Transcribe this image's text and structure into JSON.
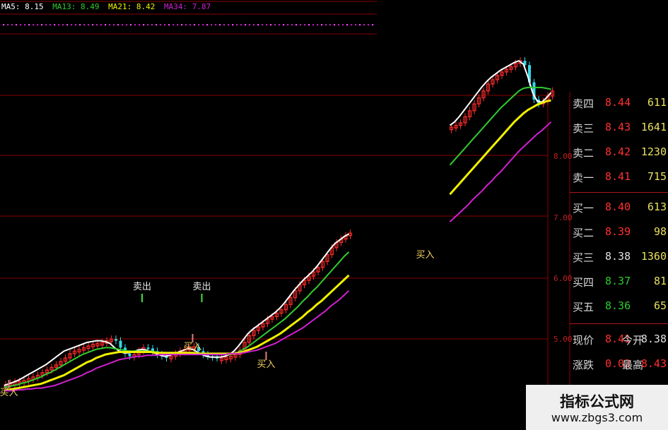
{
  "ma_legend": [
    {
      "label": "MA5: 8.15",
      "color": "#ffffff"
    },
    {
      "label": "MA13: 8.49",
      "color": "#2fcc2f"
    },
    {
      "label": "MA21: 8.42",
      "color": "#f0f000"
    },
    {
      "label": "MA34: 7.87",
      "color": "#d020d0"
    }
  ],
  "axis": {
    "y_ticks": [
      "8.00",
      "7.00",
      "6.00",
      "5.00"
    ]
  },
  "quote": {
    "sell": [
      {
        "label": "卖四",
        "price": "8.44",
        "vol": "611"
      },
      {
        "label": "卖三",
        "price": "8.43",
        "vol": "1641"
      },
      {
        "label": "卖二",
        "price": "8.42",
        "vol": "1230"
      },
      {
        "label": "卖一",
        "price": "8.41",
        "vol": "715"
      }
    ],
    "buy": [
      {
        "label": "买一",
        "price": "8.40",
        "vol": "613"
      },
      {
        "label": "买二",
        "price": "8.39",
        "vol": "98"
      },
      {
        "label": "买三",
        "price": "8.38",
        "vol": "1360"
      },
      {
        "label": "买四",
        "price": "8.37",
        "vol": "81"
      },
      {
        "label": "买五",
        "price": "8.36",
        "vol": "65"
      }
    ],
    "stats": [
      {
        "label": "现价",
        "value": "8.41",
        "label2": "今开",
        "value2": "8.38"
      },
      {
        "label": "涨跌",
        "value": "0.03",
        "label2": "最高",
        "value2": "8.43"
      }
    ]
  },
  "signals": [
    {
      "text": "买入"
    },
    {
      "text": "卖出"
    },
    {
      "text": "卖出"
    },
    {
      "text": "买入"
    },
    {
      "text": "买入"
    },
    {
      "text": "买入"
    }
  ],
  "watermark": {
    "title": "指标公式网",
    "url": "www.zbgs3.com"
  },
  "colors": {
    "up": "#ff2b2b",
    "down": "#35d9e6",
    "ma5": "#ffffff",
    "ma13": "#2fcc2f",
    "ma21": "#f0f000",
    "ma34": "#d020d0",
    "grid": "#8a0000"
  },
  "chart_data": {
    "type": "candlestick",
    "ylim": [
      4.6,
      8.6
    ],
    "segments": [
      {
        "x0": 0,
        "points": [
          4.79,
          4.81,
          4.82,
          4.83,
          4.84,
          4.86,
          4.88,
          4.9,
          4.93,
          4.96,
          4.99,
          5.02,
          5.06,
          5.1,
          5.15,
          5.18,
          5.2,
          5.22,
          5.24,
          5.26,
          5.27,
          5.28,
          5.3,
          5.32,
          5.3,
          5.22,
          5.15,
          5.12,
          5.14,
          5.18,
          5.22,
          5.21,
          5.18,
          5.14,
          5.12,
          5.1,
          5.12,
          5.15,
          5.18,
          5.2,
          5.22,
          5.23,
          5.18,
          5.14,
          5.12,
          5.11,
          5.1,
          5.1,
          5.11,
          5.12,
          5.14,
          5.19,
          5.28,
          5.36,
          5.42,
          5.46,
          5.5,
          5.55,
          5.58,
          5.62,
          5.66,
          5.72,
          5.8,
          5.88,
          5.95,
          6.0,
          6.05,
          6.1,
          6.15,
          6.22,
          6.3,
          6.38,
          6.44,
          6.48,
          6.52,
          6.55
        ]
      },
      {
        "x0": 97,
        "points": [
          7.78,
          7.8,
          7.83,
          7.9,
          7.97,
          8.05,
          8.12,
          8.2,
          8.28,
          8.33,
          8.38,
          8.42,
          8.45,
          8.48,
          8.52,
          8.55,
          8.5,
          8.3,
          8.1,
          8.05,
          8.08,
          8.14,
          8.2
        ]
      }
    ],
    "series": [
      {
        "name": "MA5",
        "color": "#ffffff",
        "segments": [
          {
            "x0": 0,
            "values": [
              4.78,
              4.8,
              4.82,
              4.84,
              4.87,
              4.9,
              4.93,
              4.96,
              4.99,
              5.02,
              5.06,
              5.1,
              5.14,
              5.18,
              5.2,
              5.22,
              5.24,
              5.26,
              5.28,
              5.29,
              5.3,
              5.3,
              5.29,
              5.27,
              5.22,
              5.18,
              5.16,
              5.16,
              5.17,
              5.19,
              5.2,
              5.19,
              5.17,
              5.15,
              5.13,
              5.12,
              5.13,
              5.15,
              5.17,
              5.19,
              5.21,
              5.2,
              5.17,
              5.14,
              5.12,
              5.11,
              5.11,
              5.11,
              5.12,
              5.14,
              5.18,
              5.24,
              5.31,
              5.38,
              5.43,
              5.47,
              5.51,
              5.55,
              5.59,
              5.63,
              5.68,
              5.74,
              5.81,
              5.88,
              5.94,
              6.0,
              6.05,
              6.1,
              6.16,
              6.23,
              6.3,
              6.37,
              6.43,
              6.47,
              6.51,
              6.54
            ]
          },
          {
            "x0": 97,
            "values": [
              7.8,
              7.84,
              7.9,
              7.97,
              8.04,
              8.11,
              8.18,
              8.25,
              8.31,
              8.36,
              8.4,
              8.44,
              8.47,
              8.5,
              8.53,
              8.55,
              8.51,
              8.36,
              8.18,
              8.08,
              8.07,
              8.12,
              8.18
            ]
          }
        ]
      },
      {
        "name": "MA13",
        "color": "#2fcc2f",
        "segments": [
          {
            "x0": 0,
            "values": [
              4.76,
              4.77,
              4.78,
              4.79,
              4.81,
              4.82,
              4.84,
              4.86,
              4.88,
              4.91,
              4.93,
              4.96,
              4.99,
              5.02,
              5.05,
              5.08,
              5.11,
              5.14,
              5.16,
              5.18,
              5.2,
              5.21,
              5.22,
              5.22,
              5.21,
              5.2,
              5.19,
              5.18,
              5.18,
              5.18,
              5.18,
              5.18,
              5.18,
              5.17,
              5.16,
              5.15,
              5.15,
              5.15,
              5.15,
              5.16,
              5.16,
              5.16,
              5.16,
              5.15,
              5.15,
              5.14,
              5.14,
              5.14,
              5.14,
              5.14,
              5.15,
              5.17,
              5.2,
              5.23,
              5.27,
              5.31,
              5.35,
              5.39,
              5.43,
              5.47,
              5.51,
              5.55,
              5.6,
              5.65,
              5.7,
              5.76,
              5.81,
              5.87,
              5.92,
              5.98,
              6.04,
              6.1,
              6.16,
              6.22,
              6.28,
              6.33
            ]
          },
          {
            "x0": 97,
            "values": [
              7.34,
              7.4,
              7.46,
              7.52,
              7.58,
              7.64,
              7.7,
              7.76,
              7.82,
              7.88,
              7.94,
              8.0,
              8.05,
              8.1,
              8.15,
              8.2,
              8.23,
              8.24,
              8.24,
              8.24,
              8.24,
              8.23,
              8.22
            ]
          }
        ]
      },
      {
        "name": "MA21",
        "color": "#f0f000",
        "segments": [
          {
            "x0": 0,
            "values": [
              4.72,
              4.73,
              4.74,
              4.75,
              4.76,
              4.77,
              4.78,
              4.79,
              4.8,
              4.82,
              4.84,
              4.86,
              4.88,
              4.9,
              4.93,
              4.96,
              4.99,
              5.02,
              5.05,
              5.07,
              5.1,
              5.12,
              5.14,
              5.15,
              5.16,
              5.17,
              5.17,
              5.17,
              5.17,
              5.17,
              5.17,
              5.17,
              5.17,
              5.16,
              5.16,
              5.16,
              5.16,
              5.16,
              5.16,
              5.16,
              5.16,
              5.16,
              5.15,
              5.15,
              5.15,
              5.15,
              5.15,
              5.15,
              5.15,
              5.15,
              5.15,
              5.16,
              5.17,
              5.19,
              5.21,
              5.23,
              5.26,
              5.29,
              5.32,
              5.35,
              5.38,
              5.42,
              5.46,
              5.5,
              5.54,
              5.58,
              5.63,
              5.67,
              5.72,
              5.76,
              5.81,
              5.86,
              5.91,
              5.96,
              6.01,
              6.06
            ]
          },
          {
            "x0": 97,
            "values": [
              7.0,
              7.06,
              7.12,
              7.18,
              7.24,
              7.3,
              7.36,
              7.42,
              7.48,
              7.54,
              7.6,
              7.66,
              7.72,
              7.78,
              7.84,
              7.89,
              7.94,
              7.98,
              8.01,
              8.04,
              8.06,
              8.08,
              8.09
            ]
          }
        ]
      },
      {
        "name": "MA34",
        "color": "#d020d0",
        "segments": [
          {
            "x0": 0,
            "values": [
              4.72,
              4.72,
              4.72,
              4.73,
              4.73,
              4.74,
              4.74,
              4.75,
              4.75,
              4.76,
              4.77,
              4.78,
              4.8,
              4.82,
              4.84,
              4.86,
              4.88,
              4.9,
              4.93,
              4.95,
              4.98,
              5.0,
              5.02,
              5.04,
              5.06,
              5.08,
              5.09,
              5.1,
              5.11,
              5.12,
              5.12,
              5.13,
              5.13,
              5.13,
              5.14,
              5.14,
              5.14,
              5.14,
              5.14,
              5.14,
              5.14,
              5.14,
              5.14,
              5.14,
              5.14,
              5.14,
              5.14,
              5.14,
              5.14,
              5.15,
              5.15,
              5.15,
              5.16,
              5.17,
              5.18,
              5.19,
              5.21,
              5.23,
              5.25,
              5.27,
              5.3,
              5.33,
              5.36,
              5.39,
              5.42,
              5.45,
              5.49,
              5.53,
              5.57,
              5.61,
              5.65,
              5.7,
              5.74,
              5.78,
              5.83,
              5.88
            ]
          },
          {
            "x0": 97,
            "values": [
              6.68,
              6.73,
              6.78,
              6.83,
              6.88,
              6.94,
              6.99,
              7.04,
              7.1,
              7.15,
              7.21,
              7.26,
              7.32,
              7.38,
              7.44,
              7.5,
              7.55,
              7.6,
              7.65,
              7.7,
              7.74,
              7.79,
              7.84
            ]
          }
        ]
      }
    ]
  }
}
